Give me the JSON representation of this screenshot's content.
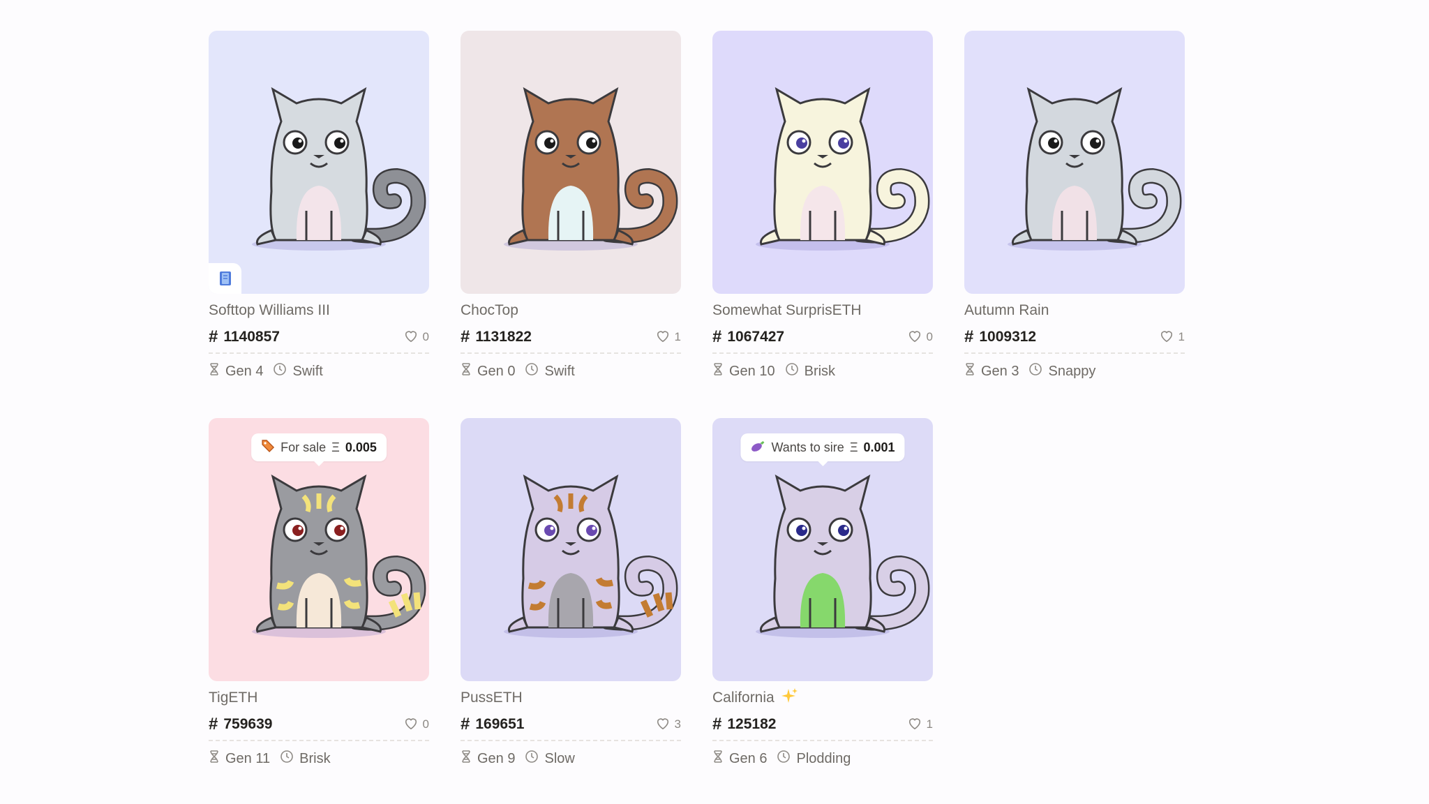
{
  "cards": [
    {
      "name": "Softtop Williams III",
      "id": "1140857",
      "likes": "0",
      "gen": "Gen 4",
      "speed": "Swift",
      "bg": "#e3e6fb",
      "fur": "#d6dbe0",
      "tail": "#8e9096",
      "belly": "#f3e4ea",
      "eye": "#1a1a1a",
      "badge": "book-icon"
    },
    {
      "name": "ChocTop",
      "id": "1131822",
      "likes": "1",
      "gen": "Gen 0",
      "speed": "Swift",
      "bg": "#efe6e8",
      "fur": "#b07552",
      "tail": "#b07552",
      "belly": "#e6f4f5",
      "eye": "#1a1a1a"
    },
    {
      "name": "Somewhat SurprisETH",
      "id": "1067427",
      "likes": "0",
      "gen": "Gen 10",
      "speed": "Brisk",
      "bg": "#dedafb",
      "fur": "#f7f4dd",
      "tail": "#f7f4dd",
      "belly": "#f5e6ea",
      "eye": "#4a3fa0"
    },
    {
      "name": "Autumn Rain",
      "id": "1009312",
      "likes": "1",
      "gen": "Gen 3",
      "speed": "Snappy",
      "bg": "#e1e0fb",
      "fur": "#d3d8de",
      "tail": "#d3d8de",
      "belly": "#f1e1e7",
      "eye": "#1a1a1a"
    },
    {
      "name": "TigETH",
      "id": "759639",
      "likes": "0",
      "gen": "Gen 11",
      "speed": "Brisk",
      "bg": "#fcdde3",
      "fur": "#9a9ba0",
      "tail": "#9a9ba0",
      "belly": "#f6e8d8",
      "eye": "#8a2020",
      "stripes": "#f3e27a",
      "sale": {
        "label": "For sale",
        "currency": "Ξ",
        "amount": "0.005"
      }
    },
    {
      "name": "PussETH",
      "id": "169651",
      "likes": "3",
      "gen": "Gen 9",
      "speed": "Slow",
      "bg": "#dcdaf6",
      "fur": "#d6cbe6",
      "tail": "#d6cbe6",
      "belly": "#a8a6ad",
      "eye": "#6a4ab0",
      "stripes": "#c37c32"
    },
    {
      "name": "California",
      "id": "125182",
      "likes": "1",
      "gen": "Gen 6",
      "speed": "Plodding",
      "bg": "#dddbf7",
      "fur": "#d8cfe6",
      "tail": "#d8cfe6",
      "belly": "#86d86c",
      "eye": "#2a2a8a",
      "sparkle": true,
      "sale": {
        "label": "Wants to sire",
        "currency": "Ξ",
        "amount": "0.001"
      }
    }
  ]
}
